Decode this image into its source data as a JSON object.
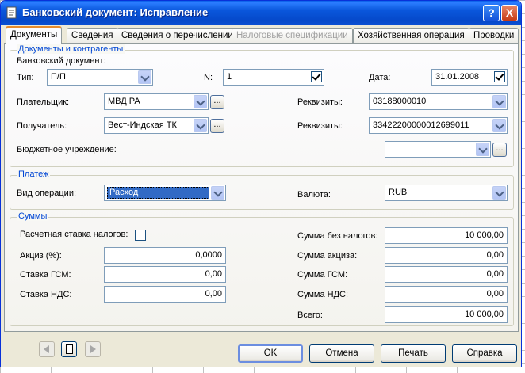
{
  "window": {
    "title": "Банковский документ: Исправление"
  },
  "tabs": [
    {
      "label": "Документы",
      "active": true
    },
    {
      "label": "Сведения"
    },
    {
      "label": "Сведения о перечислении"
    },
    {
      "label": "Налоговые спецификации",
      "disabled": true
    },
    {
      "label": "Хозяйственная операция"
    },
    {
      "label": "Проводки"
    }
  ],
  "docs": {
    "group_title": "Документы и контрагенты",
    "subtitle": "Банковский документ:",
    "type_label": "Тип:",
    "type_value": "П/П",
    "n_label": "N:",
    "n_value": "1",
    "date_label": "Дата:",
    "date_value": "31.01.2008",
    "payer_label": "Плательщик:",
    "payer_value": "МВД РА",
    "payer_req_label": "Реквизиты:",
    "payer_req_value": "03188000010",
    "receiver_label": "Получатель:",
    "receiver_value": "Вест-Индская ТК",
    "receiver_req_label": "Реквизиты:",
    "receiver_req_value": "33422200000012699011",
    "budget_label": "Бюджетное учреждение:",
    "budget_value": "",
    "ellipsis": "..."
  },
  "payment": {
    "group_title": "Платеж",
    "op_label": "Вид операции:",
    "op_value": "Расход",
    "currency_label": "Валюта:",
    "currency_value": "RUB"
  },
  "sums": {
    "group_title": "Суммы",
    "rate_label": "Расчетная ставка налогов:",
    "excise_label": "Акциз (%):",
    "excise_value": "0,0000",
    "gsm_label": "Ставка ГСМ:",
    "gsm_value": "0,00",
    "vat_label": "Ставка НДС:",
    "vat_value": "0,00",
    "without_tax_label": "Сумма без налогов:",
    "without_tax_value": "10 000,00",
    "excise_sum_label": "Сумма акциза:",
    "excise_sum_value": "0,00",
    "gsm_sum_label": "Сумма ГСМ:",
    "gsm_sum_value": "0,00",
    "vat_sum_label": "Сумма НДС:",
    "vat_sum_value": "0,00",
    "total_label": "Всего:",
    "total_value": "10 000,00"
  },
  "buttons": {
    "ok": "OK",
    "cancel": "Отмена",
    "print": "Печать",
    "help": "Справка"
  },
  "titlebar_buttons": {
    "help": "?",
    "close": "X"
  }
}
